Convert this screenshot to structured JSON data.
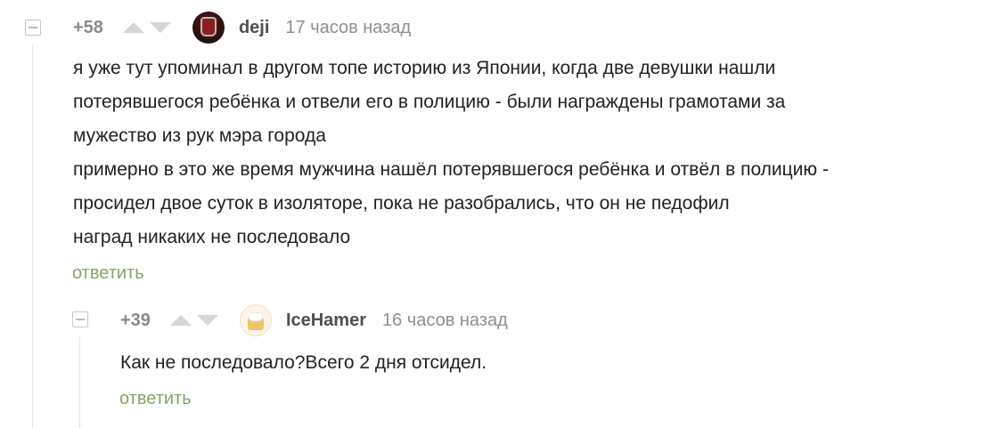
{
  "comments": [
    {
      "rating": "+58",
      "username": "deji",
      "time": "17 часов назад",
      "avatar_icon": "user-avatar-dark-cup",
      "lines": [
        "я уже тут упоминал в другом топе историю из Японии, когда две девушки нашли",
        "потерявшегося ребёнка и отвели его в полицию - были награждены грамотами за",
        "мужество из рук мэра города",
        "примерно в это же время мужчина нашёл потерявшегося ребёнка и отвёл в полицию -",
        "просидел двое суток в изоляторе, пока не разобрались, что он не педофил",
        "наград никаких не последовало"
      ],
      "reply_label": "ответить"
    },
    {
      "rating": "+39",
      "username": "IceHamer",
      "time": "16 часов назад",
      "avatar_icon": "user-avatar-beer-mug",
      "lines": [
        "Как не последовало?Всего 2 дня отсидел."
      ],
      "reply_label": "ответить"
    }
  ],
  "colors": {
    "reply_link": "#7fa868",
    "vote_arrow": "#d6d6d6",
    "rating": "#8a8a8a",
    "thread_line": "#e6e6e6"
  }
}
